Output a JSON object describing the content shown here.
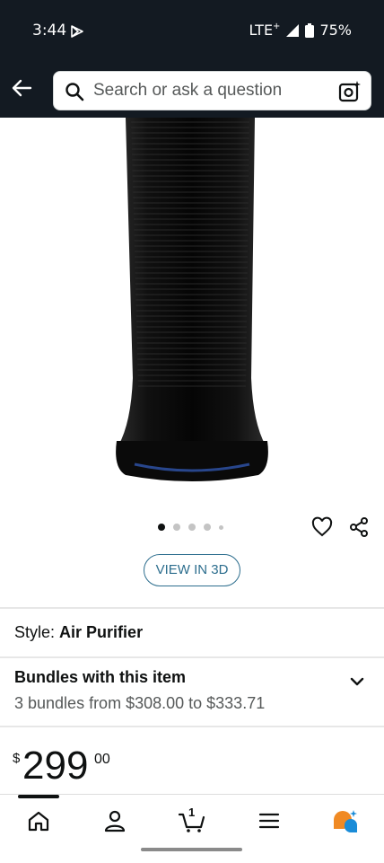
{
  "status": {
    "time": "3:44",
    "network": "LTE",
    "battery": "75%"
  },
  "header": {
    "search_placeholder": "Search or ask a question"
  },
  "gallery": {
    "view_3d_label": "VIEW IN 3D",
    "dot_count": 5,
    "active_dot": 0
  },
  "style": {
    "label": "Style:",
    "value": "Air Purifier"
  },
  "bundles": {
    "title": "Bundles with this item",
    "subtitle": "3 bundles from $308.00 to $333.71"
  },
  "price": {
    "currency": "$",
    "whole": "299",
    "fraction": "00"
  },
  "bottom_nav": {
    "cart_count": "1"
  },
  "colors": {
    "header_bg": "#131a22",
    "link": "#2d6e8e",
    "text": "#0f1111"
  }
}
